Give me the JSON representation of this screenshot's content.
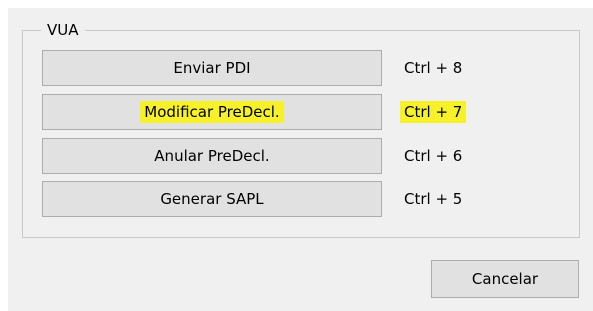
{
  "group": {
    "title": "VUA"
  },
  "actions": [
    {
      "label": "Enviar PDI",
      "shortcut": "Ctrl + 8"
    },
    {
      "label": "Modificar PreDecl.",
      "shortcut": "Ctrl + 7"
    },
    {
      "label": "Anular PreDecl.",
      "shortcut": "Ctrl + 6"
    },
    {
      "label": "Generar SAPL",
      "shortcut": "Ctrl + 5"
    }
  ],
  "footer": {
    "cancel_label": "Cancelar"
  },
  "colors": {
    "dialog_bg": "#f0f0f0",
    "button_bg": "#e1e1e1",
    "button_border": "#adadad",
    "highlight": "#f6f12a"
  }
}
